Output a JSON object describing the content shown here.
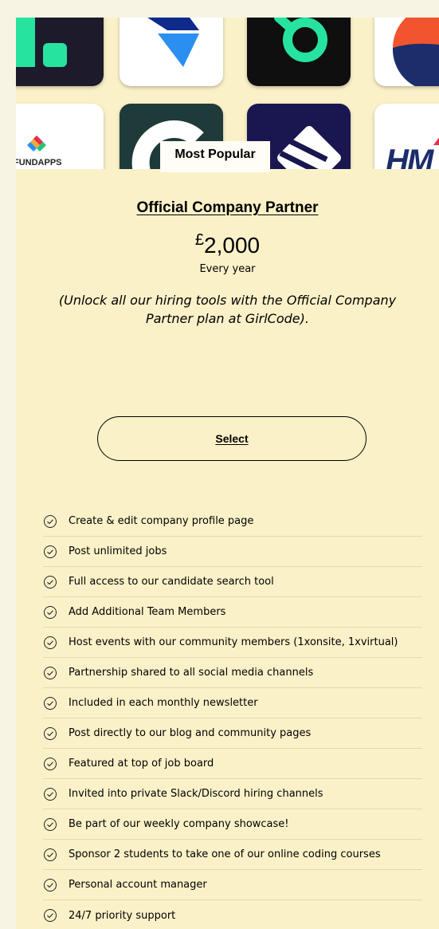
{
  "logos": [
    {
      "name": "",
      "color": "#1d1a2b"
    },
    {
      "name": "",
      "color": "#ffffff"
    },
    {
      "name": "",
      "color": "#0f0f10"
    },
    {
      "name": "",
      "color": "#ffffff"
    },
    {
      "name": "FUNDAPPS",
      "color": "#ffffff"
    },
    {
      "name": "",
      "color": "#1e3b3a"
    },
    {
      "name": "",
      "color": "#1a1650"
    },
    {
      "name": "HM",
      "color": "#ffffff"
    }
  ],
  "plan": {
    "badge": "Most Popular",
    "title": "Official Company Partner",
    "currency": "£",
    "price": "2,000",
    "period": "Every year",
    "description": "(Unlock all our hiring tools with the Official Company Partner plan at GirlCode).",
    "select_label": "Select"
  },
  "features": [
    "Create & edit company profile page",
    "Post unlimited jobs",
    "Full access to our candidate search tool",
    "Add Additional Team Members",
    "Host events with our community members (1xonsite, 1xvirtual)",
    "Partnership shared to all social media channels",
    "Included in each monthly newsletter",
    "Post directly to our blog and community pages",
    "Featured at top of job board",
    "Invited into private Slack/Discord hiring channels",
    "Be part of our weekly company showcase!",
    "Sponsor 2 students to take one of our online coding courses",
    "Personal account manager",
    "24/7 priority support"
  ],
  "colors": {
    "page_bg": "#f7f4e4",
    "card_bg": "#fbf1c8",
    "accent_green": "#27e3a0",
    "accent_blue": "#1f73e8",
    "accent_orange": "#f2542f"
  }
}
